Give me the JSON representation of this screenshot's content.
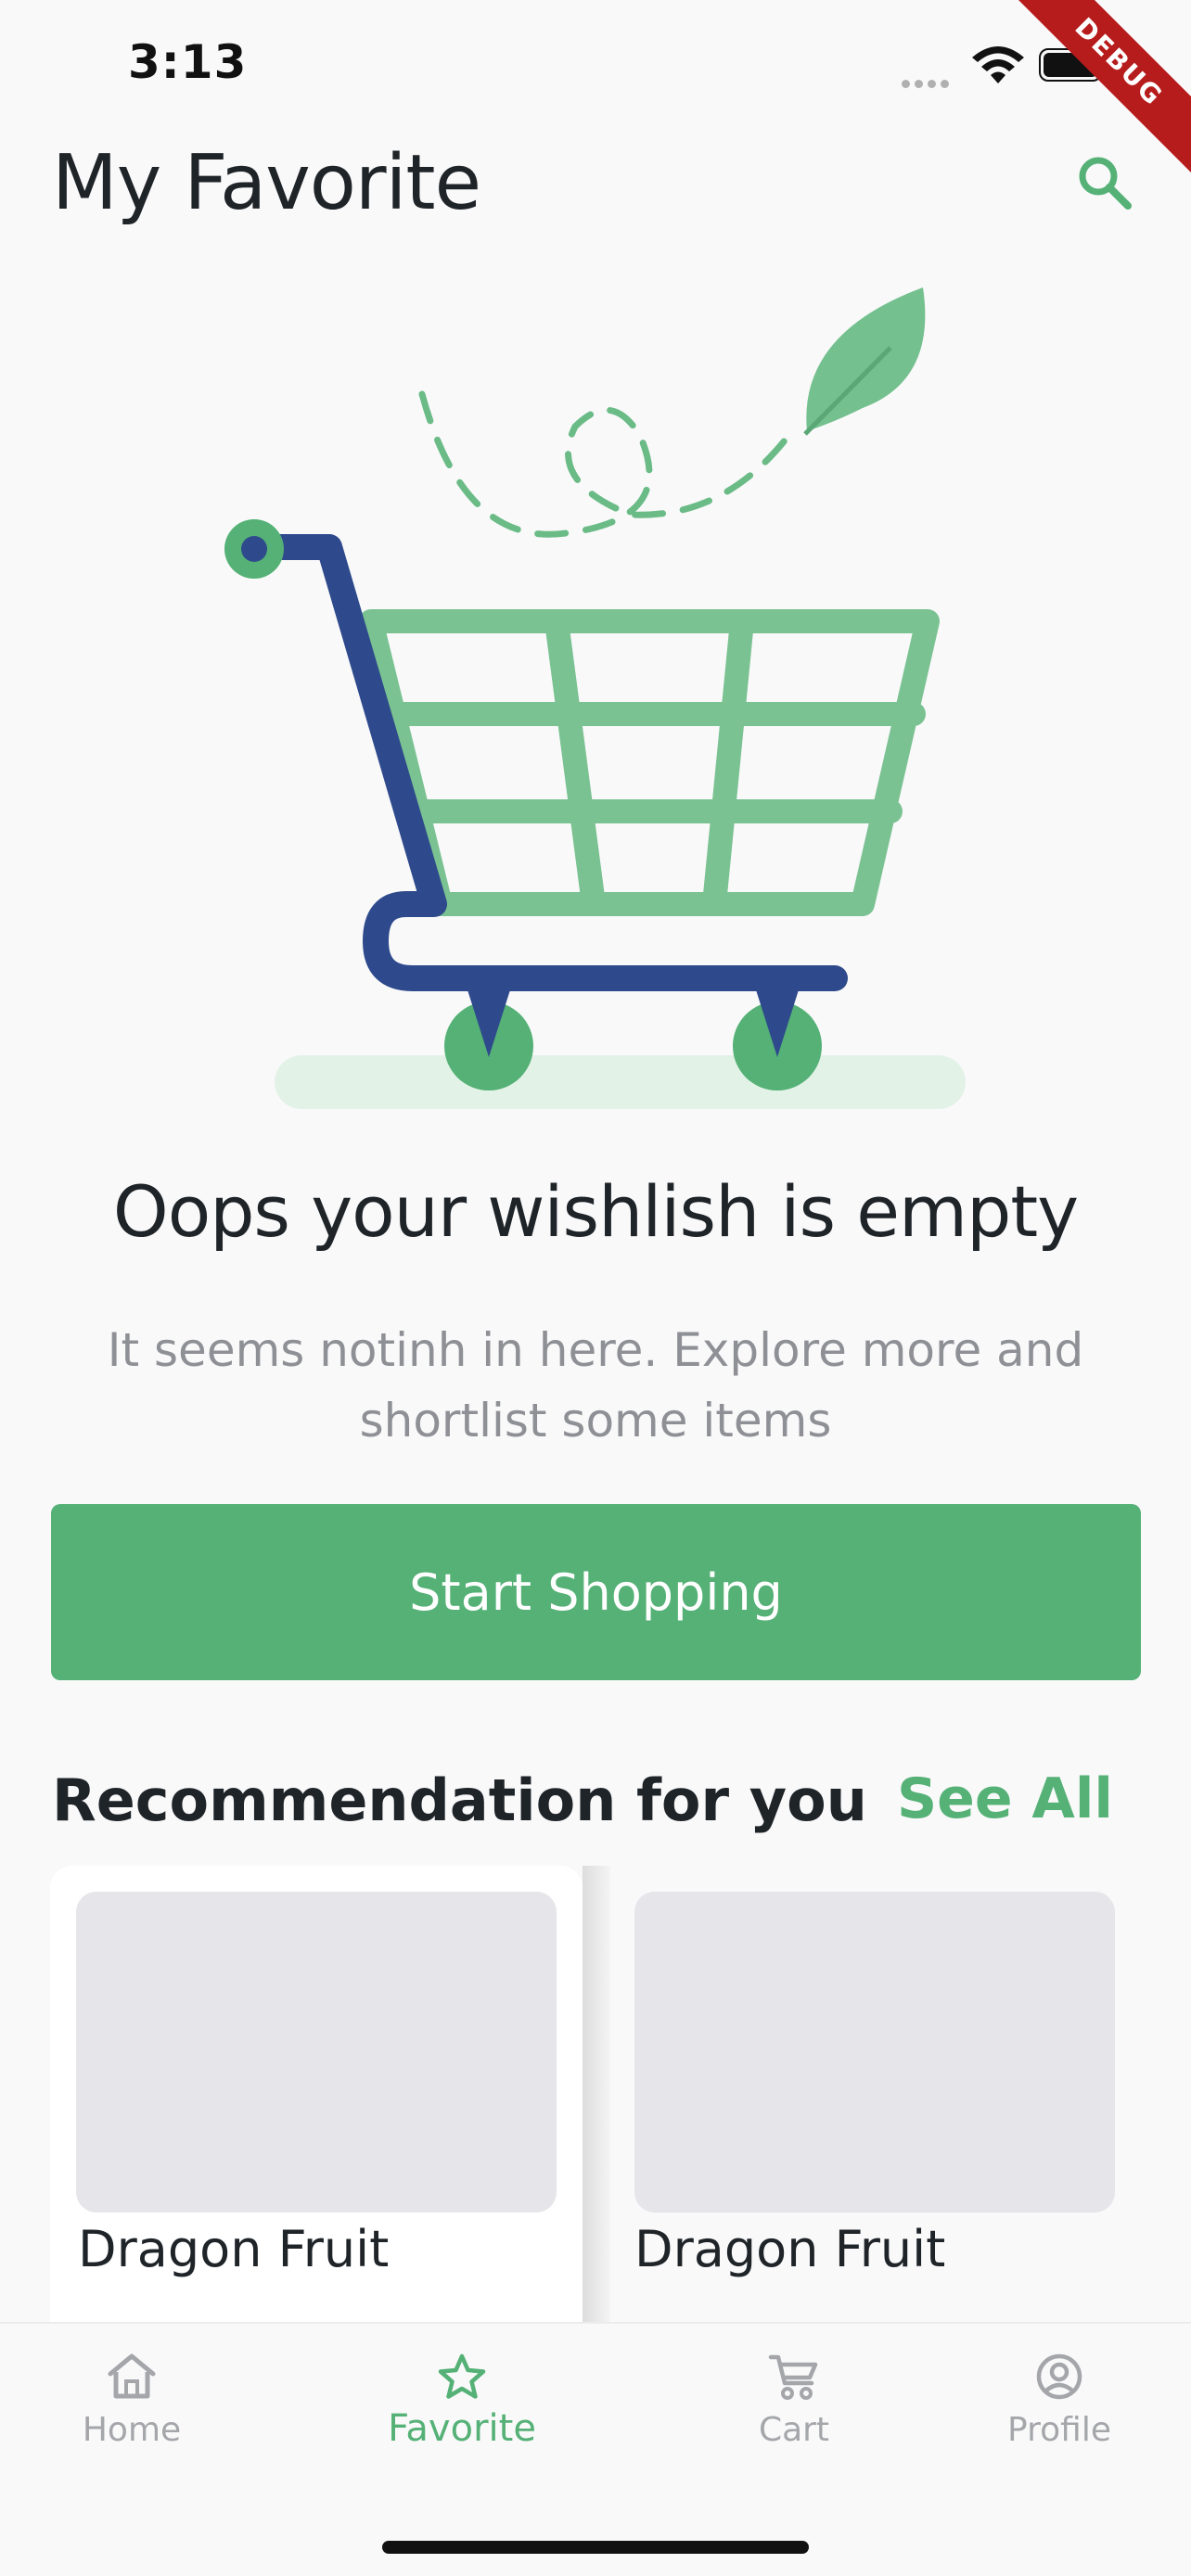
{
  "status_bar": {
    "time": "3:13",
    "debug_label": "DEBUG"
  },
  "header": {
    "title": "My Favorite",
    "search_icon": "search-icon"
  },
  "empty_state": {
    "illustration": "shopping-cart-with-leaf",
    "title": "Oops your wishlish is empty",
    "subtitle": "It seems notinh in here. Explore more and shortlist some items",
    "button_label": "Start Shopping"
  },
  "recommendation": {
    "title": "Recommendation for you",
    "see_all_label": "See All",
    "items": [
      {
        "name": "Dragon Fruit"
      },
      {
        "name": "Dragon Fruit"
      }
    ]
  },
  "bottom_nav": {
    "items": [
      {
        "label": "Home",
        "icon": "home-icon",
        "active": false
      },
      {
        "label": "Favorite",
        "icon": "star-icon",
        "active": true
      },
      {
        "label": "Cart",
        "icon": "cart-icon",
        "active": false
      },
      {
        "label": "Profile",
        "icon": "profile-icon",
        "active": false
      }
    ]
  },
  "colors": {
    "accent": "#55b176",
    "cart_blue": "#2e4a8c",
    "cart_green": "#7bc292",
    "text_dark": "#1f2429",
    "text_muted": "#8e9095"
  }
}
